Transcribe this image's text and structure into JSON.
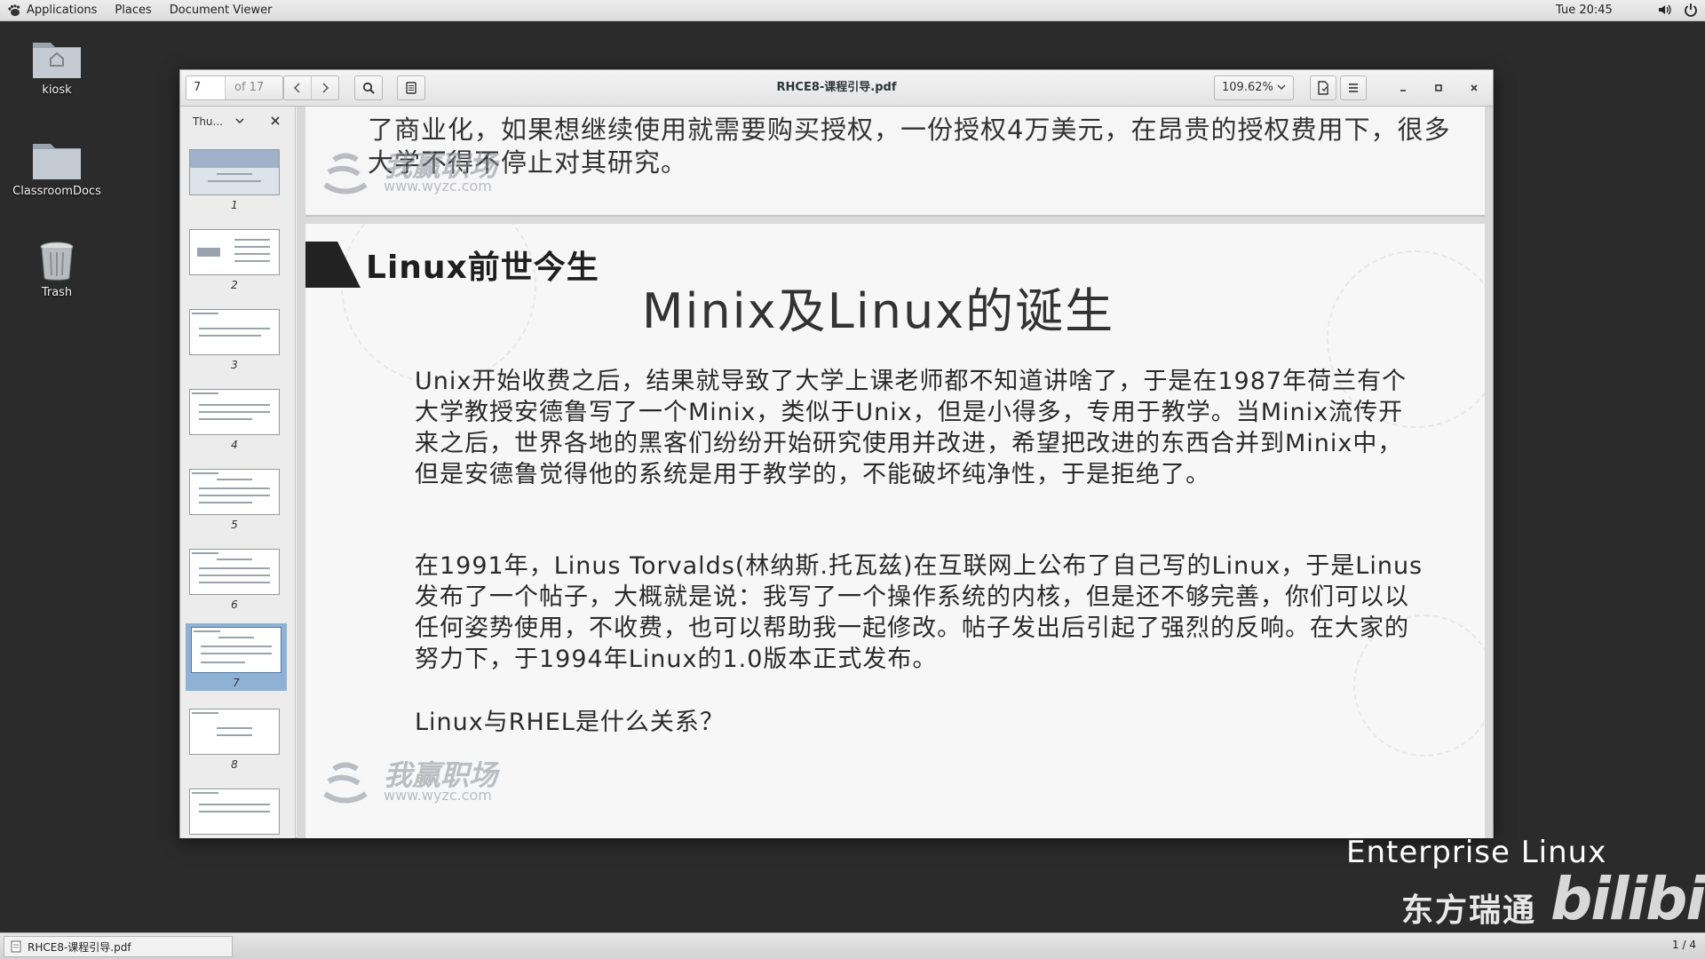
{
  "topbar": {
    "applications": "Applications",
    "places": "Places",
    "app_name": "Document Viewer",
    "clock": "Tue 20:45"
  },
  "desktop": {
    "icons": [
      {
        "label": "kiosk",
        "icon": "home-folder-icon"
      },
      {
        "label": "ClassroomDocs",
        "icon": "folder-icon"
      },
      {
        "label": "Trash",
        "icon": "trash-icon"
      }
    ]
  },
  "window": {
    "title": "RHCE8-课程引导.pdf",
    "page_current": "7",
    "page_total": "of 17",
    "zoom": "109.62%",
    "sidebar": {
      "mode": "Thu...",
      "thumbnails": [
        "1",
        "2",
        "3",
        "4",
        "5",
        "6",
        "7",
        "8"
      ],
      "active_page": "7"
    }
  },
  "document": {
    "prev_page_text": "了商业化，如果想继续使用就需要购买授权，一份授权4万美元，在昂贵的授权费用下，很多大学不得不停止对其研究。",
    "watermark_name": "我赢职场",
    "watermark_url": "www.wyzc.com",
    "section_header": "Linux前世今生",
    "slide_title": "Minix及Linux的诞生",
    "paragraphs": [
      "Unix开始收费之后，结果就导致了大学上课老师都不知道讲啥了，于是在1987年荷兰有个大学教授安德鲁写了一个Minix，类似于Unix，但是小得多，专用于教学。当Minix流传开来之后，世界各地的黑客们纷纷开始研究使用并改进，希望把改进的东西合并到Minix中，但是安德鲁觉得他的系统是用于教学的，不能破坏纯净性，于是拒绝了。",
      "在1991年，Linus Torvalds(林纳斯.托瓦兹)在互联网上公布了自己写的Linux，于是Linus发布了一个帖子，大概就是说：我写了一个操作系统的内核，但是还不够完善，你们可以以任何姿势使用，不收费，也可以帮助我一起修改。帖子发出后引起了强烈的反响。在大家的努力下，于1994年Linux的1.0版本正式发布。",
      "Linux与RHEL是什么关系？"
    ]
  },
  "branding": {
    "line1": "Enterprise Linux",
    "line2": "东方瑞通",
    "logo": "bilibili"
  },
  "taskbar": {
    "task_label": "RHCE8-课程引导.pdf",
    "workspace": "1 / 4"
  },
  "colors": {
    "desktop_bg": "#2b2b2c",
    "active_thumb": "#8fb2d4"
  }
}
